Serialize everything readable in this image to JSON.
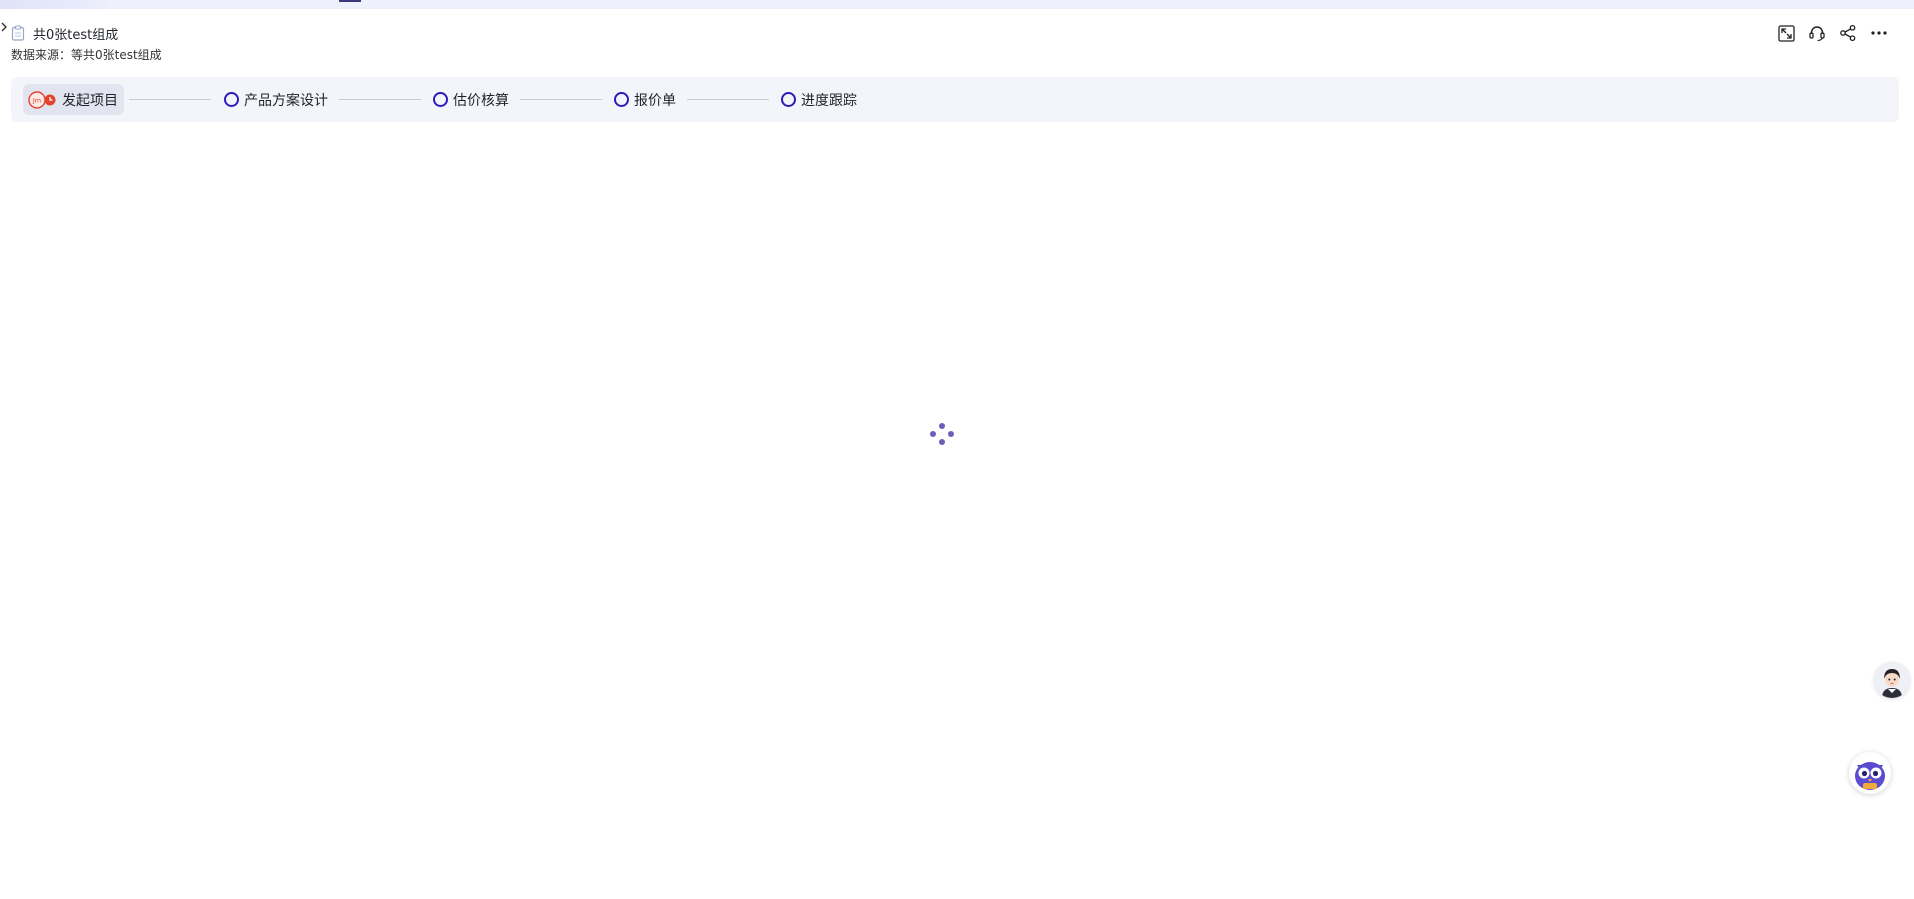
{
  "header": {
    "title": "共0张test组成",
    "source": "数据来源：等共0张test组成"
  },
  "icons": {
    "document": "document-icon",
    "expand": "fullscreen-icon",
    "support": "headset-icon",
    "share": "share-icon",
    "more": "more-icon",
    "collapse": "chevron-right-icon"
  },
  "steps": [
    {
      "label": "发起项目",
      "state": "active"
    },
    {
      "label": "产品方案设计",
      "state": "pending"
    },
    {
      "label": "估价核算",
      "state": "pending"
    },
    {
      "label": "报价单",
      "state": "pending"
    },
    {
      "label": "进度跟踪",
      "state": "pending"
    }
  ],
  "colors": {
    "step_circle": "#2b1bb8",
    "loader": "#6b5fb8",
    "launch_accent": "#e2442f",
    "stepbar_bg": "#f4f5fb"
  }
}
